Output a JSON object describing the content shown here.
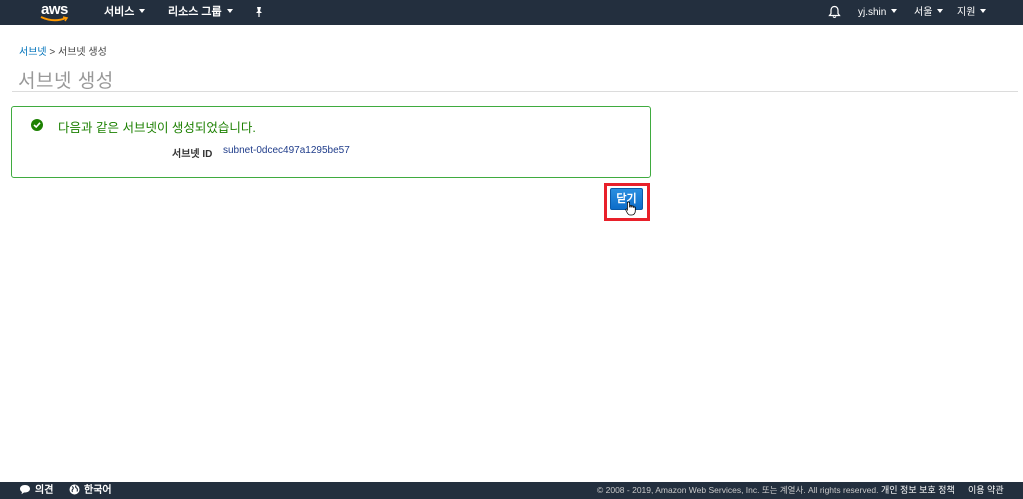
{
  "nav": {
    "logo_text": "aws",
    "services": "서비스",
    "resource_groups": "리소스 그룹",
    "user": "yj.shin",
    "region": "서울",
    "support": "지원"
  },
  "breadcrumb": {
    "link": "서브넷",
    "separator": ">",
    "current": "서브넷 생성"
  },
  "page_title": "서브넷 생성",
  "success": {
    "message": "다음과 같은 서브넷이 생성되었습니다.",
    "label": "서브넷 ID",
    "subnet_id": "subnet-0dcec497a1295be57"
  },
  "close_button": "닫기",
  "footer": {
    "feedback": "의견",
    "language": "한국어",
    "copyright": "© 2008 - 2019, Amazon Web Services, Inc. 또는 계열사. All rights reserved.",
    "privacy": "개인 정보 보호 정책",
    "terms": "이용 약관"
  },
  "colors": {
    "nav_bg": "#232f3e",
    "success_green": "#1d8102",
    "link_blue": "#0073bb",
    "highlight_red": "#e8202a"
  }
}
